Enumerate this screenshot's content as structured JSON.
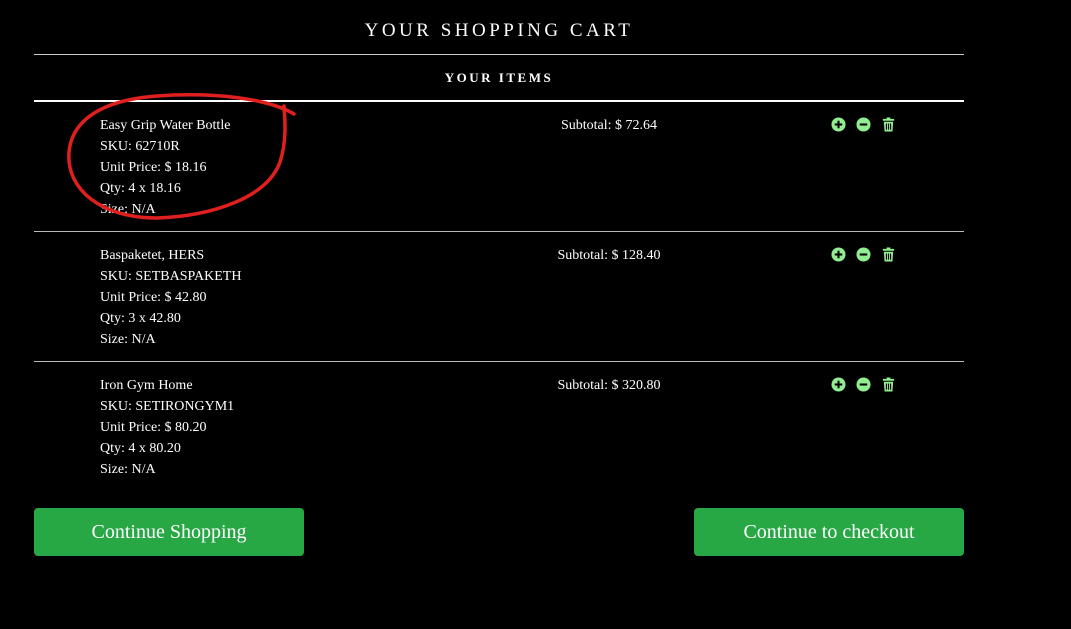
{
  "header": {
    "title": "YOUR SHOPPING CART",
    "items_heading": "YOUR ITEMS"
  },
  "items": [
    {
      "name": "Easy Grip Water Bottle",
      "sku": "SKU: 62710R",
      "unit_price": "Unit Price: $ 18.16",
      "qty": "Qty: 4 x 18.16",
      "size": "Size: N/A",
      "subtotal": "Subtotal: $ 72.64"
    },
    {
      "name": "Baspaketet, HERS",
      "sku": "SKU: SETBASPAKETH",
      "unit_price": "Unit Price: $ 42.80",
      "qty": "Qty: 3 x 42.80",
      "size": "Size: N/A",
      "subtotal": "Subtotal: $ 128.40"
    },
    {
      "name": "Iron Gym Home",
      "sku": "SKU: SETIRONGYM1",
      "unit_price": "Unit Price: $ 80.20",
      "qty": "Qty: 4 x 80.20",
      "size": "Size: N/A",
      "subtotal": "Subtotal: $ 320.80"
    }
  ],
  "icons": {
    "increase": "plus-circle-icon",
    "decrease": "minus-circle-icon",
    "remove": "trash-icon"
  },
  "buttons": {
    "continue_shopping": "Continue Shopping",
    "checkout": "Continue to checkout"
  },
  "colors": {
    "background": "#000000",
    "text": "#ffffff",
    "accent_green": "#28a745",
    "icon_green": "#90ee90",
    "annotation_red": "#e0201e"
  }
}
